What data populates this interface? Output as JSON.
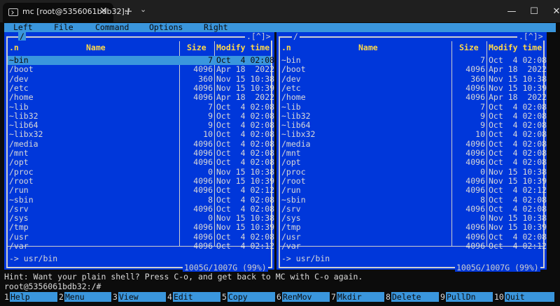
{
  "window": {
    "tab_title": "mc [root@5356061bdb32]:/",
    "new_tab": "+",
    "tab_dropdown": "⌄",
    "minimize": "—",
    "maximize": "☐",
    "close": "✕"
  },
  "menu": [
    "Left",
    "File",
    "Command",
    "Options",
    "Right"
  ],
  "panels": {
    "columns": {
      "name_sort": ".n",
      "name": "Name",
      "size": "Size",
      "mtime": "Modify time"
    },
    "left": {
      "path": "/",
      "corner": ".[^]>",
      "cursor_row": 0,
      "mini_status": "-> usr/bin",
      "footer": "1005G/1007G (99%)"
    },
    "right": {
      "path": "/",
      "corner": ".[^]>",
      "cursor_row": -1,
      "mini_status": "-> usr/bin",
      "footer": "1005G/1007G (99%)"
    },
    "files": [
      {
        "name": "~bin",
        "size": "7",
        "mtime": "Oct  4 02:08"
      },
      {
        "name": "/boot",
        "size": "4096",
        "mtime": "Apr 18  2022"
      },
      {
        "name": "/dev",
        "size": "360",
        "mtime": "Nov 15 10:38"
      },
      {
        "name": "/etc",
        "size": "4096",
        "mtime": "Nov 15 10:39"
      },
      {
        "name": "/home",
        "size": "4096",
        "mtime": "Apr 18  2022"
      },
      {
        "name": "~lib",
        "size": "7",
        "mtime": "Oct  4 02:08"
      },
      {
        "name": "~lib32",
        "size": "9",
        "mtime": "Oct  4 02:08"
      },
      {
        "name": "~lib64",
        "size": "9",
        "mtime": "Oct  4 02:08"
      },
      {
        "name": "~libx32",
        "size": "10",
        "mtime": "Oct  4 02:08"
      },
      {
        "name": "/media",
        "size": "4096",
        "mtime": "Oct  4 02:08"
      },
      {
        "name": "/mnt",
        "size": "4096",
        "mtime": "Oct  4 02:08"
      },
      {
        "name": "/opt",
        "size": "4096",
        "mtime": "Oct  4 02:08"
      },
      {
        "name": "/proc",
        "size": "0",
        "mtime": "Nov 15 10:38"
      },
      {
        "name": "/root",
        "size": "4096",
        "mtime": "Nov 15 10:39"
      },
      {
        "name": "/run",
        "size": "4096",
        "mtime": "Oct  4 02:12"
      },
      {
        "name": "~sbin",
        "size": "8",
        "mtime": "Oct  4 02:08"
      },
      {
        "name": "/srv",
        "size": "4096",
        "mtime": "Oct  4 02:08"
      },
      {
        "name": "/sys",
        "size": "0",
        "mtime": "Nov 15 10:38"
      },
      {
        "name": "/tmp",
        "size": "4096",
        "mtime": "Nov 15 10:39"
      },
      {
        "name": "/usr",
        "size": "4096",
        "mtime": "Oct  4 02:08"
      },
      {
        "name": "/var",
        "size": "4096",
        "mtime": "Oct  4 02:12"
      }
    ]
  },
  "hint": "Hint: Want your plain shell? Press C-o, and get back to MC with C-o again.",
  "prompt": "root@5356061bdb32:/#",
  "function_keys": [
    {
      "num": "1",
      "label": "Help"
    },
    {
      "num": "2",
      "label": "Menu"
    },
    {
      "num": "3",
      "label": "View"
    },
    {
      "num": "4",
      "label": "Edit"
    },
    {
      "num": "5",
      "label": "Copy"
    },
    {
      "num": "6",
      "label": "RenMov"
    },
    {
      "num": "7",
      "label": "Mkdir"
    },
    {
      "num": "8",
      "label": "Delete"
    },
    {
      "num": "9",
      "label": "PullDn"
    },
    {
      "num": "10",
      "label": "Quit"
    }
  ],
  "colors": {
    "panel_bg": "#0037da",
    "menu_bg": "#3a96dd",
    "header_text": "#ffd84a",
    "terminal_bg": "#0c0c0c"
  }
}
